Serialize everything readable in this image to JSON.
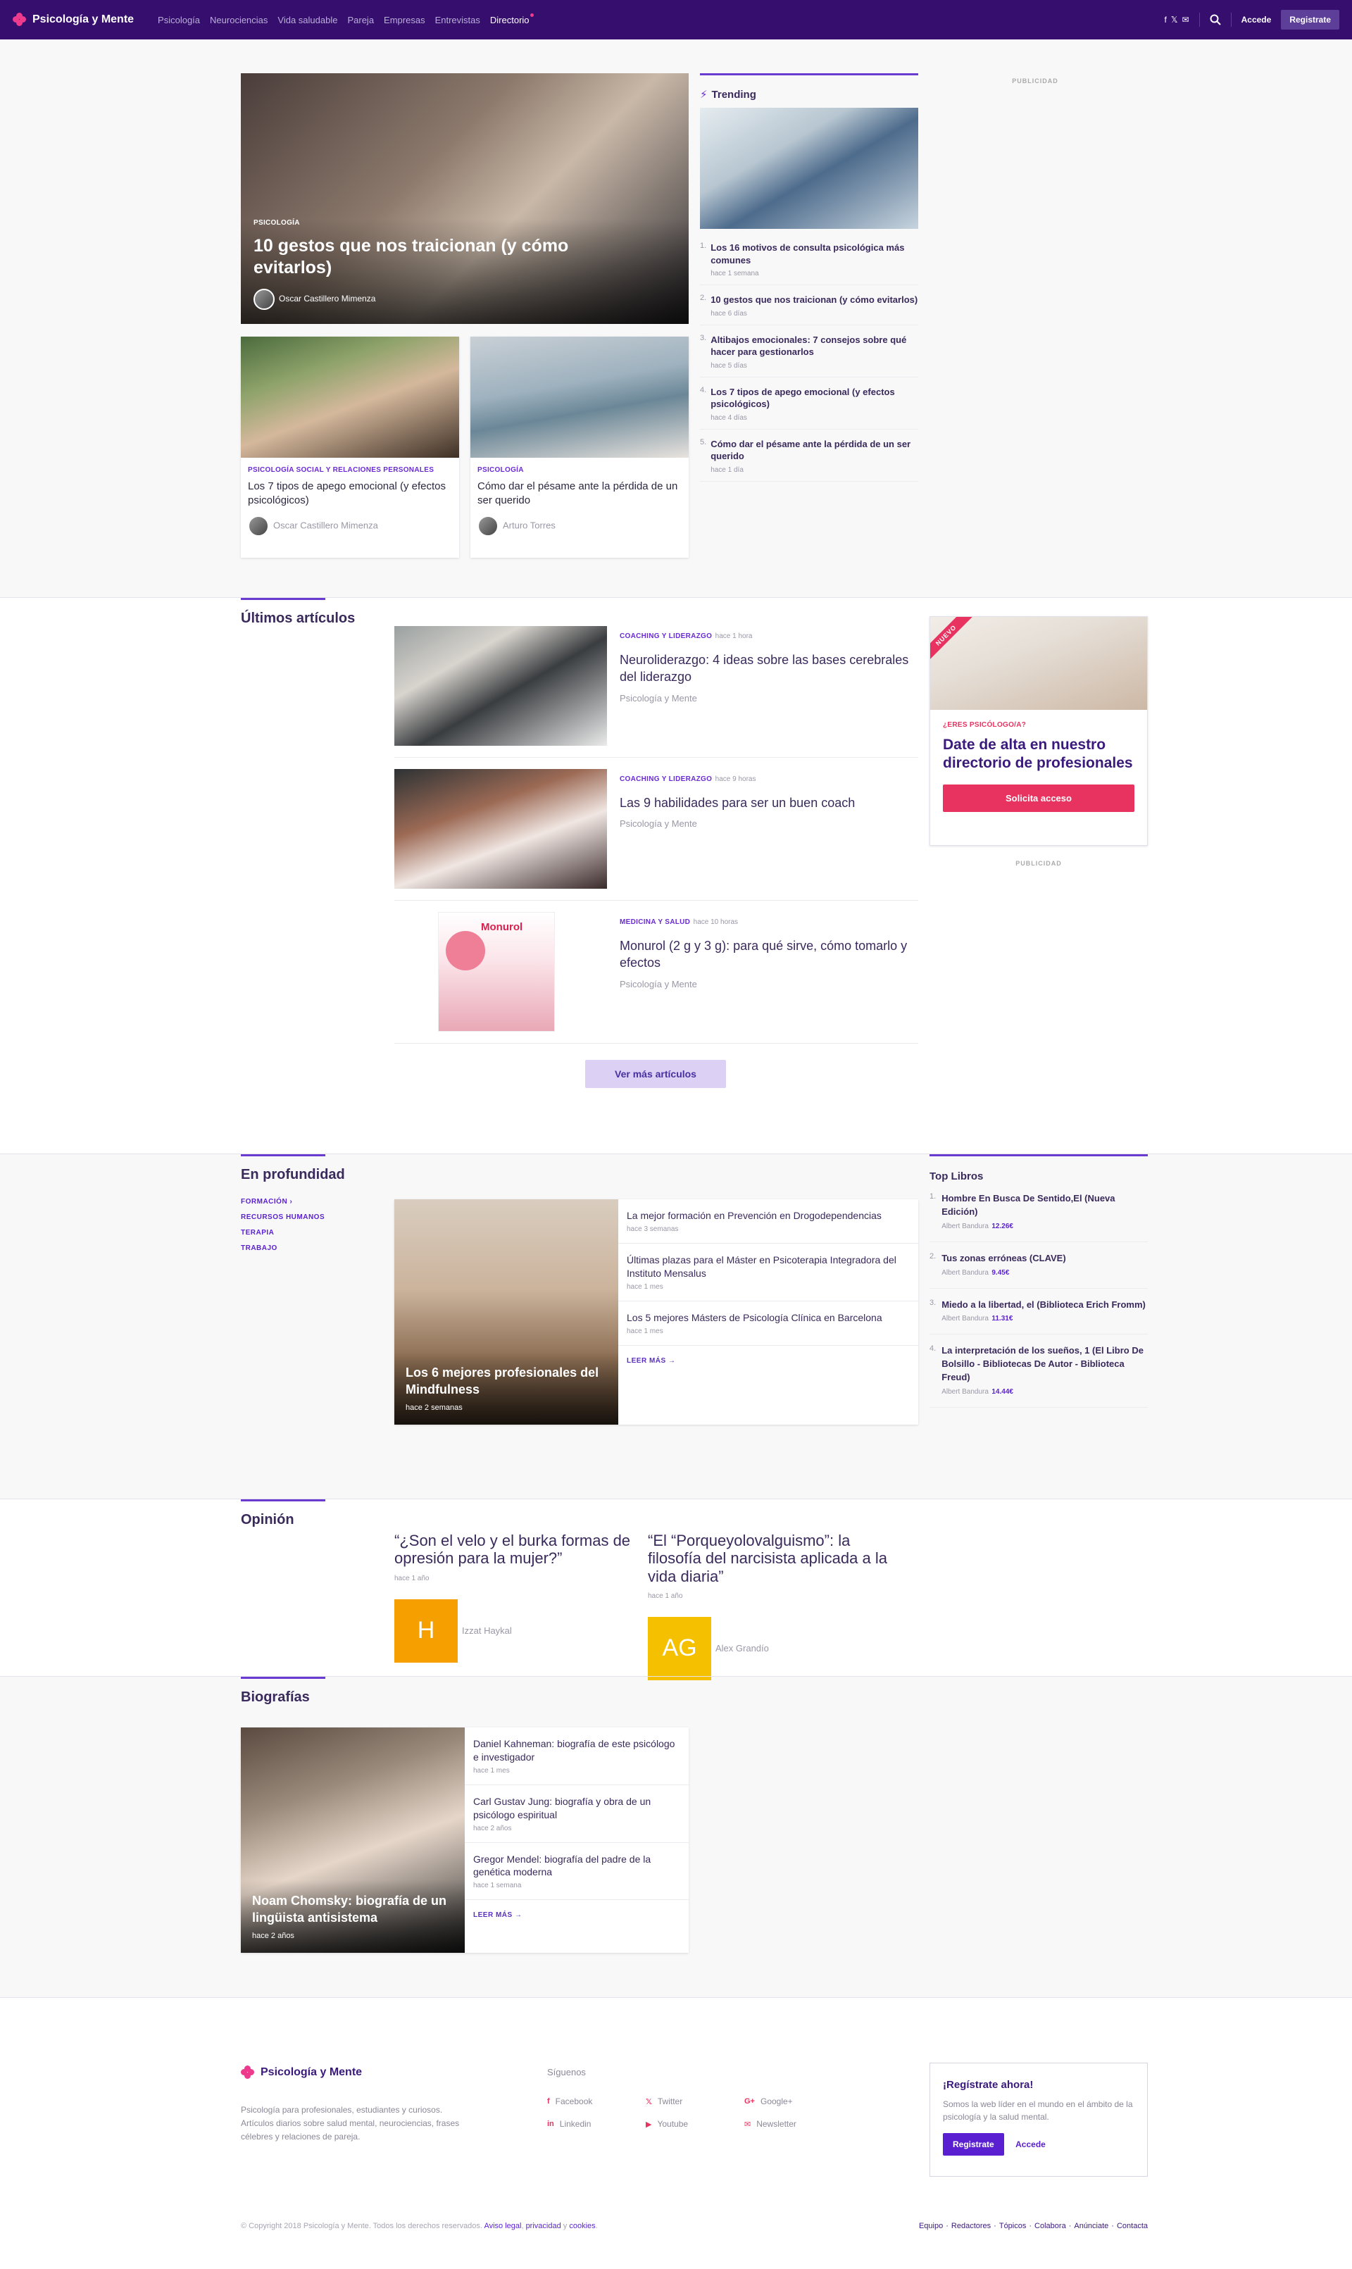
{
  "header": {
    "brand": "Psicología y Mente",
    "nav": [
      "Psicología",
      "Neurociencias",
      "Vida saludable",
      "Pareja",
      "Empresas",
      "Entrevistas",
      "Directorio"
    ],
    "login": "Accede",
    "register": "Registrate"
  },
  "hero": {
    "category": "PSICOLOGÍA",
    "title": "10 gestos que nos traicionan (y cómo evitarlos)",
    "author": "Oscar Castillero Mimenza"
  },
  "cards": [
    {
      "category": "PSICOLOGÍA SOCIAL Y RELACIONES PERSONALES",
      "title": "Los 7 tipos de apego emocional (y efectos psicológicos)",
      "author": "Oscar Castillero Mimenza"
    },
    {
      "category": "PSICOLOGÍA",
      "title": "Cómo dar el pésame ante la pérdida de un ser querido",
      "author": "Arturo Torres"
    }
  ],
  "trending": {
    "title": "Trending",
    "items": [
      {
        "n": "1.",
        "title": "Los 16 motivos de consulta psicológica más comunes",
        "time": "hace 1 semana"
      },
      {
        "n": "2.",
        "title": "10 gestos que nos traicionan (y cómo evitarlos)",
        "time": "hace 6 días"
      },
      {
        "n": "3.",
        "title": "Altibajos emocionales: 7 consejos sobre qué hacer para gestionarlos",
        "time": "hace 5 días"
      },
      {
        "n": "4.",
        "title": "Los 7 tipos de apego emocional (y efectos psicológicos)",
        "time": "hace 4 días"
      },
      {
        "n": "5.",
        "title": "Cómo dar el pésame ante la pérdida de un ser querido",
        "time": "hace 1 día"
      }
    ]
  },
  "publicidad": "PUBLICIDAD",
  "ultimos": {
    "title": "Últimos artículos",
    "items": [
      {
        "category": "COACHING Y LIDERAZGO",
        "time": "hace 1 hora",
        "title": "Neuroliderazgo: 4 ideas sobre las bases cerebrales del liderazgo",
        "author": "Psicología y Mente"
      },
      {
        "category": "COACHING Y LIDERAZGO",
        "time": "hace 9 horas",
        "title": "Las 9 habilidades para ser un buen coach",
        "author": "Psicología y Mente"
      },
      {
        "category": "MEDICINA Y SALUD",
        "time": "hace 10 horas",
        "title": "Monurol (2 g y 3 g): para qué sirve, cómo tomarlo y efectos",
        "author": "Psicología y Mente"
      }
    ],
    "more": "Ver más artículos"
  },
  "promo": {
    "badge": "NUEVO",
    "eyebrow": "¿ERES PSICÓLOGO/A?",
    "title": "Date de alta en nuestro directorio de profesionales",
    "button": "Solicita acceso"
  },
  "profundidad": {
    "title": "En profundidad",
    "tags": [
      "FORMACIÓN",
      "RECURSOS HUMANOS",
      "TERAPIA",
      "TRABAJO"
    ],
    "feature": {
      "title": "Los 6 mejores profesionales del Mindfulness",
      "time": "hace 2 semanas"
    },
    "items": [
      {
        "title": "La mejor formación en Prevención en Drogodependencias",
        "time": "hace 3 semanas"
      },
      {
        "title": "Últimas plazas para el Máster en Psicoterapia Integradora del Instituto Mensalus",
        "time": "hace 1 mes"
      },
      {
        "title": "Los 5 mejores Másters de Psicología Clínica en Barcelona",
        "time": "hace 1 mes"
      }
    ],
    "more": "LEER MÁS"
  },
  "libros": {
    "title": "Top Libros",
    "items": [
      {
        "n": "1.",
        "title": "Hombre En Busca De Sentido,El (Nueva Edición)",
        "author": "Albert Bandura",
        "price": "12.26€"
      },
      {
        "n": "2.",
        "title": "Tus zonas erróneas (CLAVE)",
        "author": "Albert Bandura",
        "price": "9.45€"
      },
      {
        "n": "3.",
        "title": "Miedo a la libertad, el (Biblioteca Erich Fromm)",
        "author": "Albert Bandura",
        "price": "11.31€"
      },
      {
        "n": "4.",
        "title": "La interpretación de los sueños, 1 (El Libro De Bolsillo - Bibliotecas De Autor - Biblioteca Freud)",
        "author": "Albert Bandura",
        "price": "14.44€"
      }
    ]
  },
  "opinion": {
    "title": "Opinión",
    "items": [
      {
        "quote": "“¿Son el velo y el burka formas de opresión para la mujer?”",
        "time": "hace 1 año",
        "initials": "H",
        "author": "Izzat Haykal",
        "color": "#f5a000"
      },
      {
        "quote": "“El “Porqueyolovalguismo”: la filosofía del narcisista aplicada a la vida diaria”",
        "time": "hace 1 año",
        "initials": "AG",
        "author": "Alex Grandío",
        "color": "#f5c000"
      }
    ]
  },
  "biografias": {
    "title": "Biografías",
    "feature": {
      "title": "Noam Chomsky: biografía de un lingüista antisistema",
      "time": "hace 2 años"
    },
    "items": [
      {
        "title": "Daniel Kahneman: biografía de este psicólogo e investigador",
        "time": "hace 1 mes"
      },
      {
        "title": "Carl Gustav Jung: biografía y obra de un psicólogo espiritual",
        "time": "hace 2 años"
      },
      {
        "title": "Gregor Mendel: biografía del padre de la genética moderna",
        "time": "hace 1 semana"
      }
    ],
    "more": "LEER MÁS"
  },
  "footer": {
    "brand": "Psicología y Mente",
    "desc": "Psicología para profesionales, estudiantes y curiosos. Artículos diarios sobre salud mental, neurociencias, frases célebres y relaciones de pareja.",
    "follow": "Síguenos",
    "social": [
      "Facebook",
      "Twitter",
      "Google+",
      "Linkedin",
      "Youtube",
      "Newsletter"
    ],
    "reg_title": "¡Regístrate ahora!",
    "reg_text": "Somos la web líder en el mundo en el ámbito de la psicología y la salud mental.",
    "reg_button": "Registrate",
    "reg_login": "Accede",
    "copyright": "© Copyright 2018 Psicología y Mente. Todos los derechos reservados.",
    "legal": "Aviso legal",
    "privacy": "privacidad",
    "and": "y",
    "cookies": "cookies",
    "links": [
      "Equipo",
      "Redactores",
      "Tópicos",
      "Colabora",
      "Anúnciate",
      "Contacta"
    ]
  },
  "colors": {
    "header": "#360e6e",
    "accent": "#6a2bd6",
    "pink": "#e8325f"
  }
}
